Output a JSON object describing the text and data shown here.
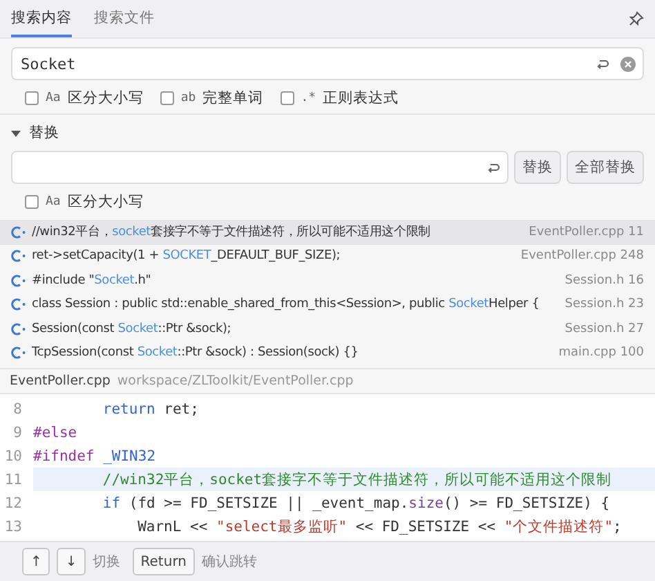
{
  "tabs": [
    {
      "label": "搜索内容",
      "selected": true
    },
    {
      "label": "搜索文件",
      "selected": false
    }
  ],
  "search": {
    "value": "Socket",
    "options": [
      {
        "icon": "Aa",
        "label": "区分大小写",
        "checked": false
      },
      {
        "icon": "ab",
        "label": "完整单词",
        "checked": false
      },
      {
        "icon": ".*",
        "label": "正则表达式",
        "checked": false
      }
    ]
  },
  "replace": {
    "title": "替换",
    "expanded": true,
    "buttons": [
      "替换",
      "全部替换"
    ],
    "options": [
      {
        "icon": "Aa",
        "label": "区分大小写",
        "checked": false
      }
    ]
  },
  "results": [
    {
      "before": "//win32平台，",
      "match": "socket",
      "after": "套接字不等于文件描述符，所以可能不适用这个限制",
      "location": "EventPoller.cpp 11",
      "selected": true
    },
    {
      "before": "ret->setCapacity(1 + ",
      "match": "SOCKET",
      "after": "_DEFAULT_BUF_SIZE);",
      "location": "EventPoller.cpp 248",
      "selected": false
    },
    {
      "before": "#include \"",
      "match": "Socket",
      "after": ".h\"",
      "location": "Session.h 16",
      "selected": false
    },
    {
      "before": "class Session : public std::enable_shared_from_this<Session>, public ",
      "match": "Socket",
      "after": "Helper {",
      "location": "Session.h 23",
      "selected": false
    },
    {
      "before": "Session(const ",
      "match": "Socket",
      "after": "::Ptr &sock);",
      "location": "Session.h 27",
      "selected": false
    },
    {
      "before": "TcpSession(const ",
      "match": "Socket",
      "after": "::Ptr &sock) : Session(sock) {}",
      "location": "main.cpp 100",
      "selected": false
    }
  ],
  "preview": {
    "file": "EventPoller.cpp",
    "path": "workspace/ZLToolkit/EventPoller.cpp",
    "lines": [
      {
        "number": "8",
        "highlighted": false,
        "kind": "block",
        "tokens": [
          {
            "kind": "keyword",
            "text": "return"
          },
          {
            "kind": "plain",
            "text": " ret;"
          }
        ]
      },
      {
        "number": "9",
        "highlighted": false,
        "kind": "top",
        "tokens": [
          {
            "kind": "preproc",
            "text": "#else"
          }
        ]
      },
      {
        "number": "10",
        "highlighted": false,
        "kind": "top",
        "tokens": [
          {
            "kind": "preproc",
            "text": "#ifndef"
          },
          {
            "kind": "keyword",
            "text": " _WIN32"
          }
        ]
      },
      {
        "number": "11",
        "highlighted": true,
        "kind": "block",
        "tokens": [
          {
            "kind": "comment",
            "text": "//win32平台，socket套接字不等于文件描述符，所以可能不适用这个限制"
          }
        ]
      },
      {
        "number": "12",
        "highlighted": false,
        "kind": "block",
        "tokens": [
          {
            "kind": "keyword",
            "text": "if"
          },
          {
            "kind": "plain",
            "text": " (fd >= FD_SETSIZE || _event_map."
          },
          {
            "kind": "func",
            "text": "size"
          },
          {
            "kind": "plain",
            "text": "() >= FD_SETSIZE) {"
          }
        ]
      },
      {
        "number": "13",
        "highlighted": false,
        "kind": "inner",
        "tokens": [
          {
            "kind": "plain",
            "text": "WarnL << "
          },
          {
            "kind": "string",
            "text": "\"select最多监听\""
          },
          {
            "kind": "plain",
            "text": " << FD_SETSIZE << "
          },
          {
            "kind": "string",
            "text": "\"个文件描述符\""
          },
          {
            "kind": "plain",
            "text": ";"
          }
        ]
      }
    ]
  },
  "footer": {
    "keys": [
      {
        "key": "↑"
      },
      {
        "key": "↓"
      }
    ],
    "switch_label": "切换",
    "confirm_key": "Return",
    "confirm_label": "确认跳转"
  }
}
